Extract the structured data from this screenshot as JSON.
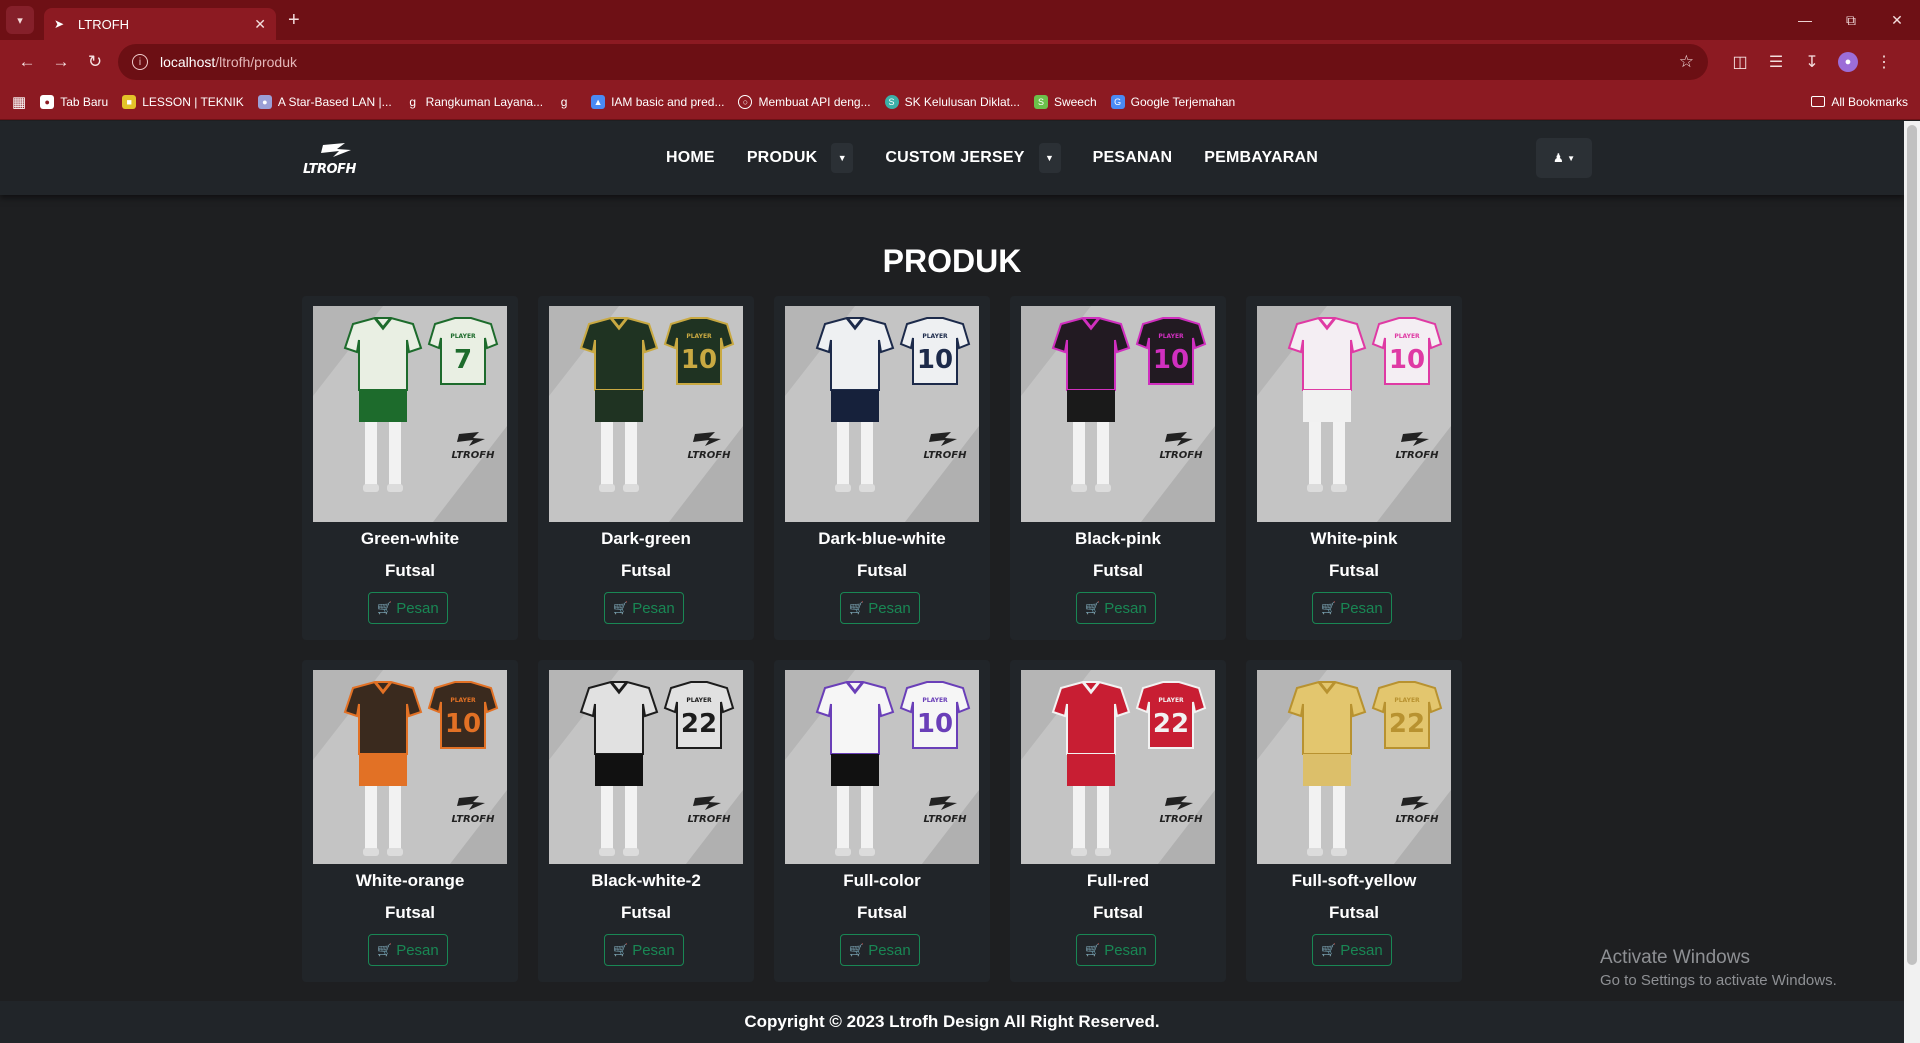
{
  "browser": {
    "tab_title": "LTROFH",
    "url_host": "localhost",
    "url_path": "/ltrofh/produk",
    "bookmarks": [
      {
        "label": "Tab Baru",
        "color": "#ffffff"
      },
      {
        "label": "LESSON | TEKNIK",
        "color": "#e3c329"
      },
      {
        "label": "A Star-Based LAN |...",
        "color": "#9b9fd6"
      },
      {
        "label": "Rangkuman Layana...",
        "color": "#ffffff"
      },
      {
        "label": "",
        "color": "#ffffff"
      },
      {
        "label": "IAM basic and pred...",
        "color": "#4a8af4"
      },
      {
        "label": "Membuat API deng...",
        "color": "#ffffff"
      },
      {
        "label": "SK Kelulusan Diklat...",
        "color": "#3cb0a8"
      },
      {
        "label": "Sweech",
        "color": "#6cc04a"
      },
      {
        "label": "Google Terjemahan",
        "color": "#4a8af4"
      }
    ],
    "all_bookmarks_label": "All Bookmarks"
  },
  "site": {
    "logo_text": "LTROFH",
    "menu": {
      "home": "HOME",
      "produk": "PRODUK",
      "custom_jersey": "CUSTOM JERSEY",
      "pesanan": "PESANAN",
      "pembayaran": "PEMBAYARAN"
    },
    "page_title": "PRODUK",
    "order_label": "Pesan",
    "products": [
      {
        "name": "Green-white",
        "category": "Futsal",
        "jersey": "#e9efe3",
        "accent": "#1d6b2c",
        "shorts": "#1d6b2c",
        "number": "7"
      },
      {
        "name": "Dark-green",
        "category": "Futsal",
        "jersey": "#1f3322",
        "accent": "#c9a942",
        "shorts": "#1f3322",
        "number": "10"
      },
      {
        "name": "Dark-blue-white",
        "category": "Futsal",
        "jersey": "#eef0f2",
        "accent": "#1c2a4a",
        "shorts": "#16213b",
        "number": "10"
      },
      {
        "name": "Black-pink",
        "category": "Futsal",
        "jersey": "#221a22",
        "accent": "#d02fbf",
        "shorts": "#1a1a1a",
        "number": "10"
      },
      {
        "name": "White-pink",
        "category": "Futsal",
        "jersey": "#f4eef3",
        "accent": "#df3aa4",
        "shorts": "#f1f1f1",
        "number": "10"
      },
      {
        "name": "White-orange",
        "category": "Futsal",
        "jersey": "#3a2a1e",
        "accent": "#e27125",
        "shorts": "#e27125",
        "number": "10"
      },
      {
        "name": "Black-white-2",
        "category": "Futsal",
        "jersey": "#e1e1e1",
        "accent": "#1c1c1c",
        "shorts": "#111111",
        "number": "22"
      },
      {
        "name": "Full-color",
        "category": "Futsal",
        "jersey": "#f6f6f6",
        "accent": "#6a3fb8",
        "shorts": "#111111",
        "number": "10"
      },
      {
        "name": "Full-red",
        "category": "Futsal",
        "jersey": "#c81e33",
        "accent": "#f2f2f2",
        "shorts": "#c81e33",
        "number": "22"
      },
      {
        "name": "Full-soft-yellow",
        "category": "Futsal",
        "jersey": "#e3c66e",
        "accent": "#b89230",
        "shorts": "#dcbf6a",
        "number": "22"
      }
    ],
    "footer": "Copyright © 2023 Ltrofh Design All Right Reserved."
  },
  "os_watermark": {
    "title": "Activate Windows",
    "subtitle": "Go to Settings to activate Windows."
  }
}
